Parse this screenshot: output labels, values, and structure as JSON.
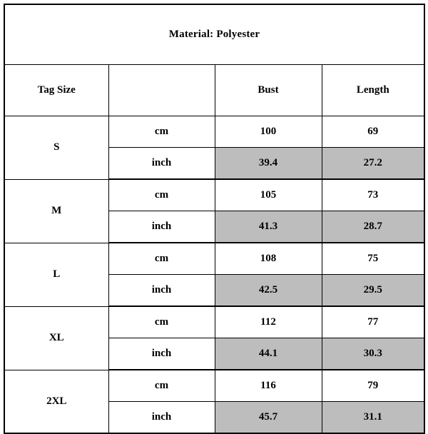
{
  "title": "Material: Polyester",
  "columns": {
    "tag_size": "Tag Size",
    "unit": "",
    "bust": "Bust",
    "length": "Length"
  },
  "units": {
    "metric": "cm",
    "imperial": "inch"
  },
  "colors": {
    "imperial_row_fill": "#bdbdbd",
    "border": "#000000",
    "background": "#ffffff"
  },
  "chart_data": {
    "type": "table",
    "title": "Material: Polyester",
    "columns": [
      "Tag Size",
      "",
      "Bust",
      "Length"
    ],
    "rows": [
      {
        "size": "S",
        "unit": "cm",
        "bust": "100",
        "length": "69"
      },
      {
        "size": "S",
        "unit": "inch",
        "bust": "39.4",
        "length": "27.2"
      },
      {
        "size": "M",
        "unit": "cm",
        "bust": "105",
        "length": "73"
      },
      {
        "size": "M",
        "unit": "inch",
        "bust": "41.3",
        "length": "28.7"
      },
      {
        "size": "L",
        "unit": "cm",
        "bust": "108",
        "length": "75"
      },
      {
        "size": "L",
        "unit": "inch",
        "bust": "42.5",
        "length": "29.5"
      },
      {
        "size": "XL",
        "unit": "cm",
        "bust": "112",
        "length": "77"
      },
      {
        "size": "XL",
        "unit": "inch",
        "bust": "44.1",
        "length": "30.3"
      },
      {
        "size": "2XL",
        "unit": "cm",
        "bust": "116",
        "length": "79"
      },
      {
        "size": "2XL",
        "unit": "inch",
        "bust": "45.7",
        "length": "31.1"
      }
    ]
  },
  "sizes": [
    {
      "label": "S",
      "cm": {
        "unit": "cm",
        "bust": "100",
        "length": "69"
      },
      "inch": {
        "unit": "inch",
        "bust": "39.4",
        "length": "27.2"
      }
    },
    {
      "label": "M",
      "cm": {
        "unit": "cm",
        "bust": "105",
        "length": "73"
      },
      "inch": {
        "unit": "inch",
        "bust": "41.3",
        "length": "28.7"
      }
    },
    {
      "label": "L",
      "cm": {
        "unit": "cm",
        "bust": "108",
        "length": "75"
      },
      "inch": {
        "unit": "inch",
        "bust": "42.5",
        "length": "29.5"
      }
    },
    {
      "label": "XL",
      "cm": {
        "unit": "cm",
        "bust": "112",
        "length": "77"
      },
      "inch": {
        "unit": "inch",
        "bust": "44.1",
        "length": "30.3"
      }
    },
    {
      "label": "2XL",
      "cm": {
        "unit": "cm",
        "bust": "116",
        "length": "79"
      },
      "inch": {
        "unit": "inch",
        "bust": "45.7",
        "length": "31.1"
      }
    }
  ]
}
